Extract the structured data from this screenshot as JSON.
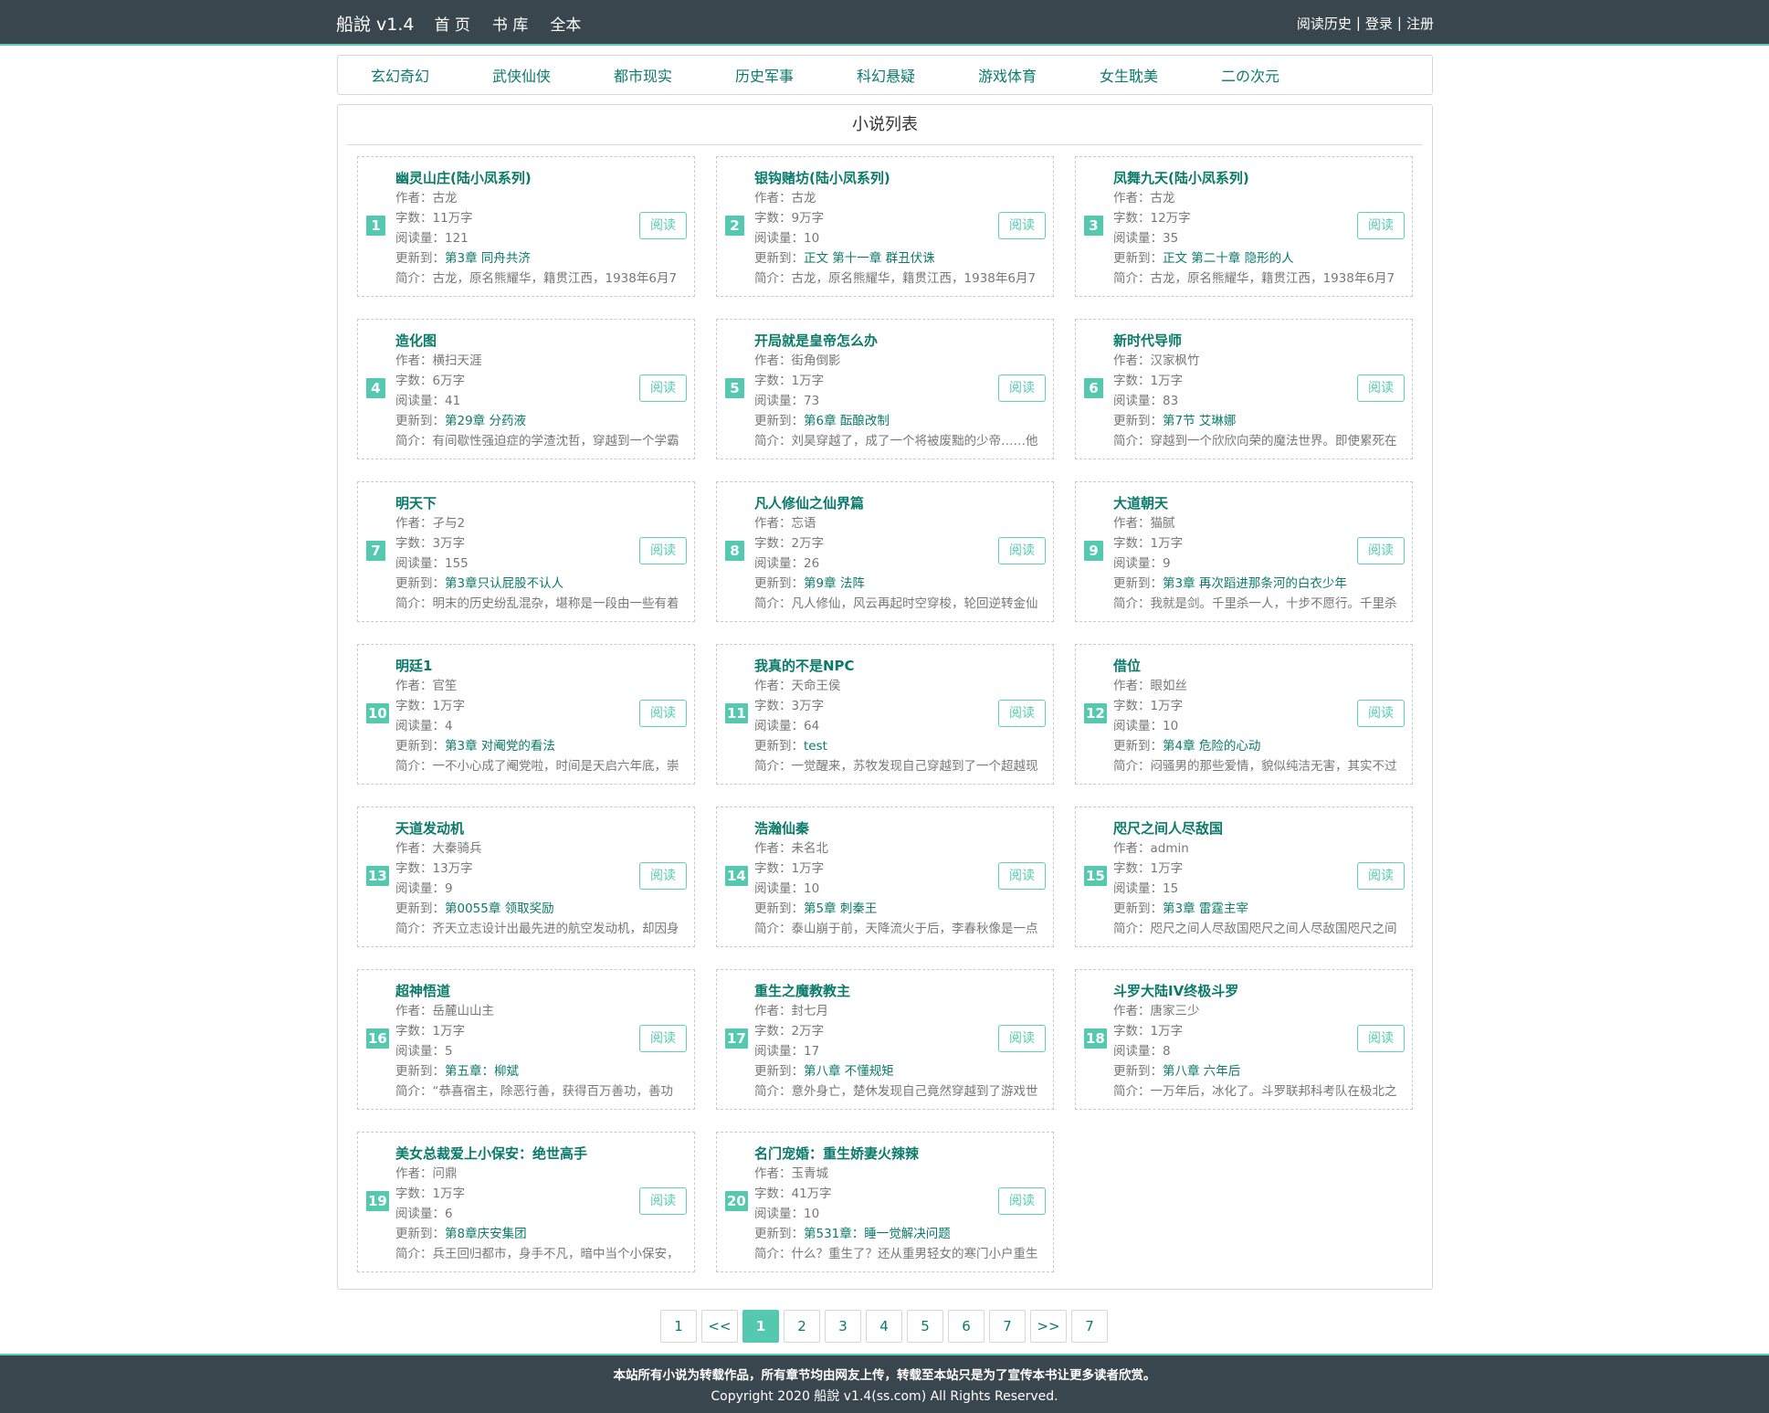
{
  "header": {
    "brand": "船說 v1.4",
    "nav": [
      "首 页",
      "书 库",
      "全本"
    ],
    "history": "阅读历史",
    "login": "登录",
    "register": "注册",
    "sep": "|"
  },
  "categories": [
    "玄幻奇幻",
    "武侠仙侠",
    "都市现实",
    "历史军事",
    "科幻悬疑",
    "游戏体育",
    "女生耽美",
    "二の次元"
  ],
  "panel_title": "小说列表",
  "labels": {
    "author": "作者：",
    "words": "字数：",
    "reads": "阅读量：",
    "updated": "更新到：",
    "intro": "简介：",
    "read_button": "阅读"
  },
  "novels": [
    {
      "rank": "1",
      "title": "幽灵山庄(陆小凤系列)",
      "author": "古龙",
      "words": "11万字",
      "reads": "121",
      "latest": "第3章 同舟共济",
      "intro": "古龙，原名熊耀华，籍贯江西，1938年6月7"
    },
    {
      "rank": "2",
      "title": "银钩赌坊(陆小凤系列)",
      "author": "古龙",
      "words": "9万字",
      "reads": "10",
      "latest": "正文 第十一章 群丑伏诛",
      "intro": "古龙，原名熊耀华，籍贯江西，1938年6月7"
    },
    {
      "rank": "3",
      "title": "凤舞九天(陆小凤系列)",
      "author": "古龙",
      "words": "12万字",
      "reads": "35",
      "latest": "正文 第二十章 隐形的人",
      "intro": "古龙，原名熊耀华，籍贯江西，1938年6月7"
    },
    {
      "rank": "4",
      "title": "造化图",
      "author": "横扫天涯",
      "words": "6万字",
      "reads": "41",
      "latest": "第29章 分药液",
      "intro": "有间歇性强迫症的学渣沈哲，穿越到一个学霸"
    },
    {
      "rank": "5",
      "title": "开局就是皇帝怎么办",
      "author": "街角倒影",
      "words": "1万字",
      "reads": "73",
      "latest": "第6章 酝酿改制",
      "intro": "刘昊穿越了，成了一个将被废黜的少帝……他"
    },
    {
      "rank": "6",
      "title": "新时代导师",
      "author": "汉家枫竹",
      "words": "1万字",
      "reads": "83",
      "latest": "第7节 艾琳娜",
      "intro": "穿越到一个欣欣向荣的魔法世界。即使累死在"
    },
    {
      "rank": "7",
      "title": "明天下",
      "author": "孑与2",
      "words": "3万字",
      "reads": "155",
      "latest": "第3章只认屁股不认人",
      "intro": "明末的历史纷乱混杂，堪称是一段由一些有着"
    },
    {
      "rank": "8",
      "title": "凡人修仙之仙界篇",
      "author": "忘语",
      "words": "2万字",
      "reads": "26",
      "latest": "第9章 法阵",
      "intro": "凡人修仙，风云再起时空穿梭，轮回逆转金仙"
    },
    {
      "rank": "9",
      "title": "大道朝天",
      "author": "猫腻",
      "words": "1万字",
      "reads": "9",
      "latest": "第3章 再次蹈进那条河的白衣少年",
      "intro": "我就是剑。千里杀一人，十步不愿行。千里杀"
    },
    {
      "rank": "10",
      "title": "明廷1",
      "author": "官笙",
      "words": "1万字",
      "reads": "4",
      "latest": "第3章 对阉党的看法",
      "intro": "一不小心成了阉党啦，时间是天启六年底，崇"
    },
    {
      "rank": "11",
      "title": "我真的不是NPC",
      "author": "天命王侯",
      "words": "3万字",
      "reads": "64",
      "latest": "test",
      "intro": "一觉醒来，苏牧发现自己穿越到了一个超越现"
    },
    {
      "rank": "12",
      "title": "借位",
      "author": "眼如丝",
      "words": "1万字",
      "reads": "10",
      "latest": "第4章 危险的心动",
      "intro": "闷骚男的那些爱情，貌似纯洁无害，其实不过"
    },
    {
      "rank": "13",
      "title": "天道发动机",
      "author": "大秦骑兵",
      "words": "13万字",
      "reads": "9",
      "latest": "第0055章 领取奖励",
      "intro": "齐天立志设计出最先进的航空发动机，却因身"
    },
    {
      "rank": "14",
      "title": "浩瀚仙秦",
      "author": "未名北",
      "words": "1万字",
      "reads": "10",
      "latest": "第5章 刺秦王",
      "intro": "泰山崩于前，天降流火于后，李春秋像是一点"
    },
    {
      "rank": "15",
      "title": "咫尺之间人尽敌国",
      "author": "admin",
      "words": "1万字",
      "reads": "15",
      "latest": "第3章 雷霆主宰",
      "intro": "咫尺之间人尽敌国咫尺之间人尽敌国咫尺之间"
    },
    {
      "rank": "16",
      "title": "超神悟道",
      "author": "岳麓山山主",
      "words": "1万字",
      "reads": "5",
      "latest": "第五章：柳斌",
      "intro": "“恭喜宿主，除恶行善，获得百万善功，善功"
    },
    {
      "rank": "17",
      "title": "重生之魔教教主",
      "author": "封七月",
      "words": "2万字",
      "reads": "17",
      "latest": "第八章 不懂规矩",
      "intro": "意外身亡，楚休发现自己竟然穿越到了游戏世"
    },
    {
      "rank": "18",
      "title": "斗罗大陆IV终极斗罗",
      "author": "唐家三少",
      "words": "1万字",
      "reads": "8",
      "latest": "第八章 六年后",
      "intro": "一万年后，冰化了。斗罗联邦科考队在极北之"
    },
    {
      "rank": "19",
      "title": "美女总裁爱上小保安：绝世高手",
      "author": "问鼎",
      "words": "1万字",
      "reads": "6",
      "latest": "第8章庆安集团",
      "intro": "兵王回归都市，身手不凡，暗中当个小保安，"
    },
    {
      "rank": "20",
      "title": "名门宠婚：重生娇妻火辣辣",
      "author": "玉青城",
      "words": "41万字",
      "reads": "10",
      "latest": "第531章：睡一觉解决问题",
      "intro": "什么？重生了？还从重男轻女的寒门小户重生"
    }
  ],
  "pagination": [
    "1",
    "<<",
    "1",
    "2",
    "3",
    "4",
    "5",
    "6",
    "7",
    ">>",
    "7"
  ],
  "pagination_active_index": 2,
  "footer": {
    "line1": "本站所有小说为转载作品，所有章节均由网友上传，转载至本站只是为了宣传本书让更多读者欣赏。",
    "line2": "Copyright 2020 船說 v1.4(ss.com) All Rights Reserved."
  },
  "colors": {
    "topbar": "#3a464e",
    "accent": "#55c9b0",
    "link": "#0b7a6a"
  }
}
